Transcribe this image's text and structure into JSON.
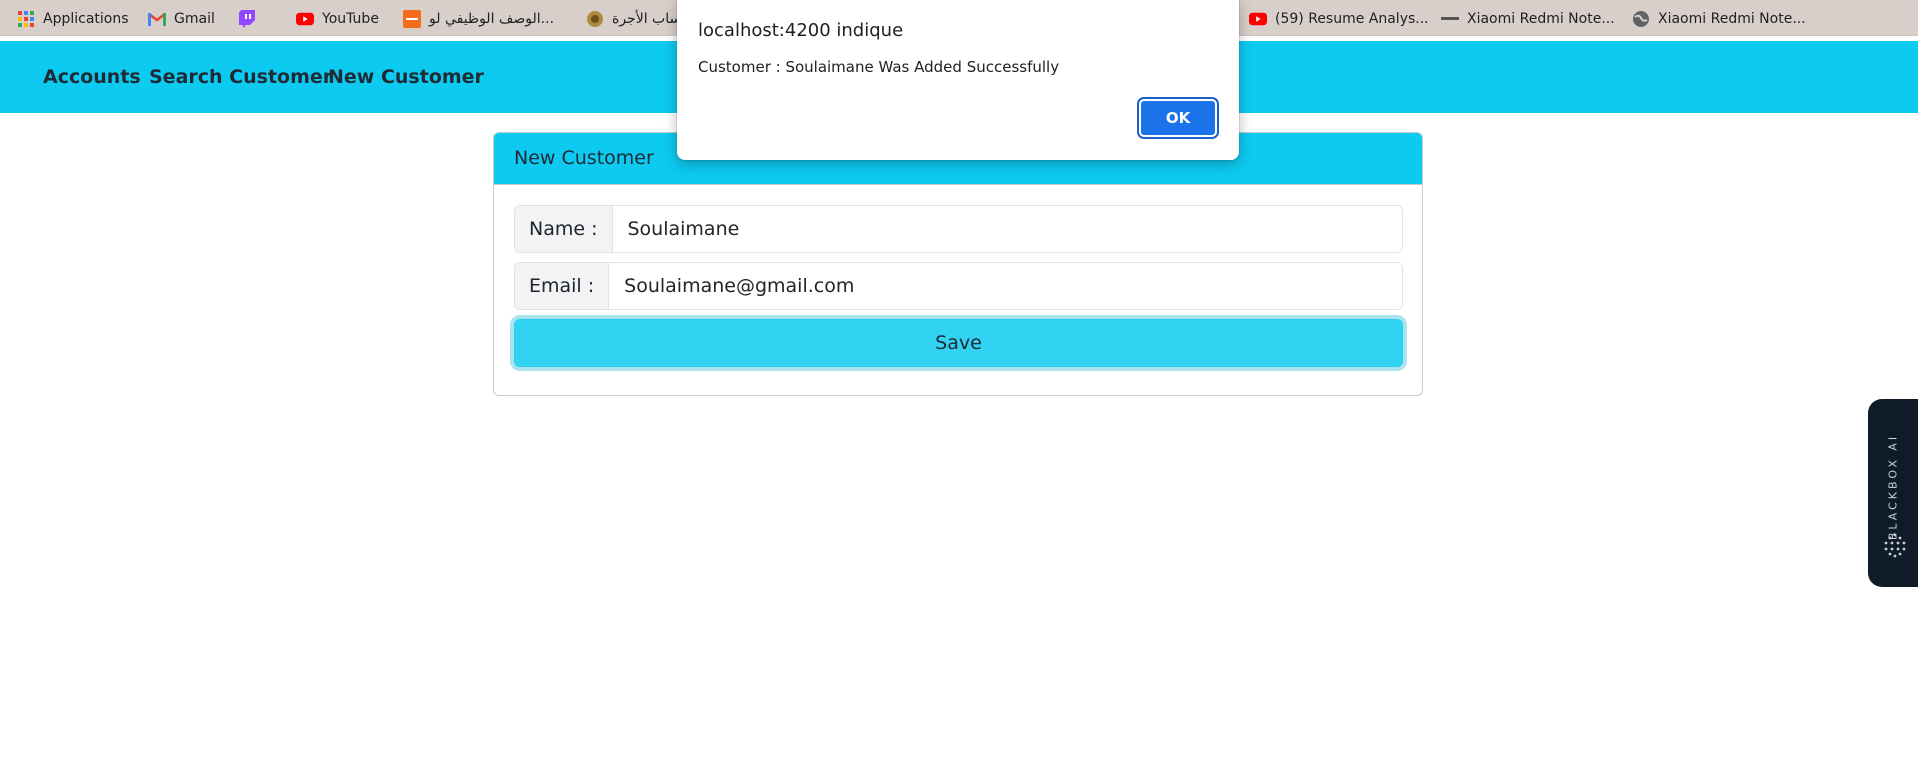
{
  "bookmarks": [
    {
      "label": "Applications",
      "icon": "apps-grid-icon"
    },
    {
      "label": "Gmail",
      "icon": "gmail-icon"
    },
    {
      "label": "",
      "icon": "twitch-icon"
    },
    {
      "label": "YouTube",
      "icon": "youtube-icon"
    },
    {
      "label": "الوصف الوظيفي لو...",
      "icon": "orange-site-icon"
    },
    {
      "label": "ساب الأجرة",
      "icon": "emblem-icon"
    },
    {
      "label": "(59) Resume Analys...",
      "icon": "youtube-icon"
    },
    {
      "label": "Xiaomi Redmi Note...",
      "icon": "dash-icon"
    },
    {
      "label": "Xiaomi Redmi Note...",
      "icon": "globe-icon"
    }
  ],
  "navbar": {
    "links": [
      "Accounts",
      "Search Customer",
      "New Customer"
    ],
    "color": "#0dcaf0"
  },
  "form": {
    "header": "New Customer",
    "name_label": "Name :",
    "name_value": "Soulaimane",
    "email_label": "Email :",
    "email_value": "Soulaimane@gmail.com",
    "save_label": "Save"
  },
  "dialog": {
    "title": "localhost:4200 indique",
    "message": "Customer : Soulaimane Was Added Successfully",
    "ok_label": "OK",
    "ok_color": "#1a73e8"
  },
  "side_widget": {
    "label": "BLACKBOX AI"
  }
}
